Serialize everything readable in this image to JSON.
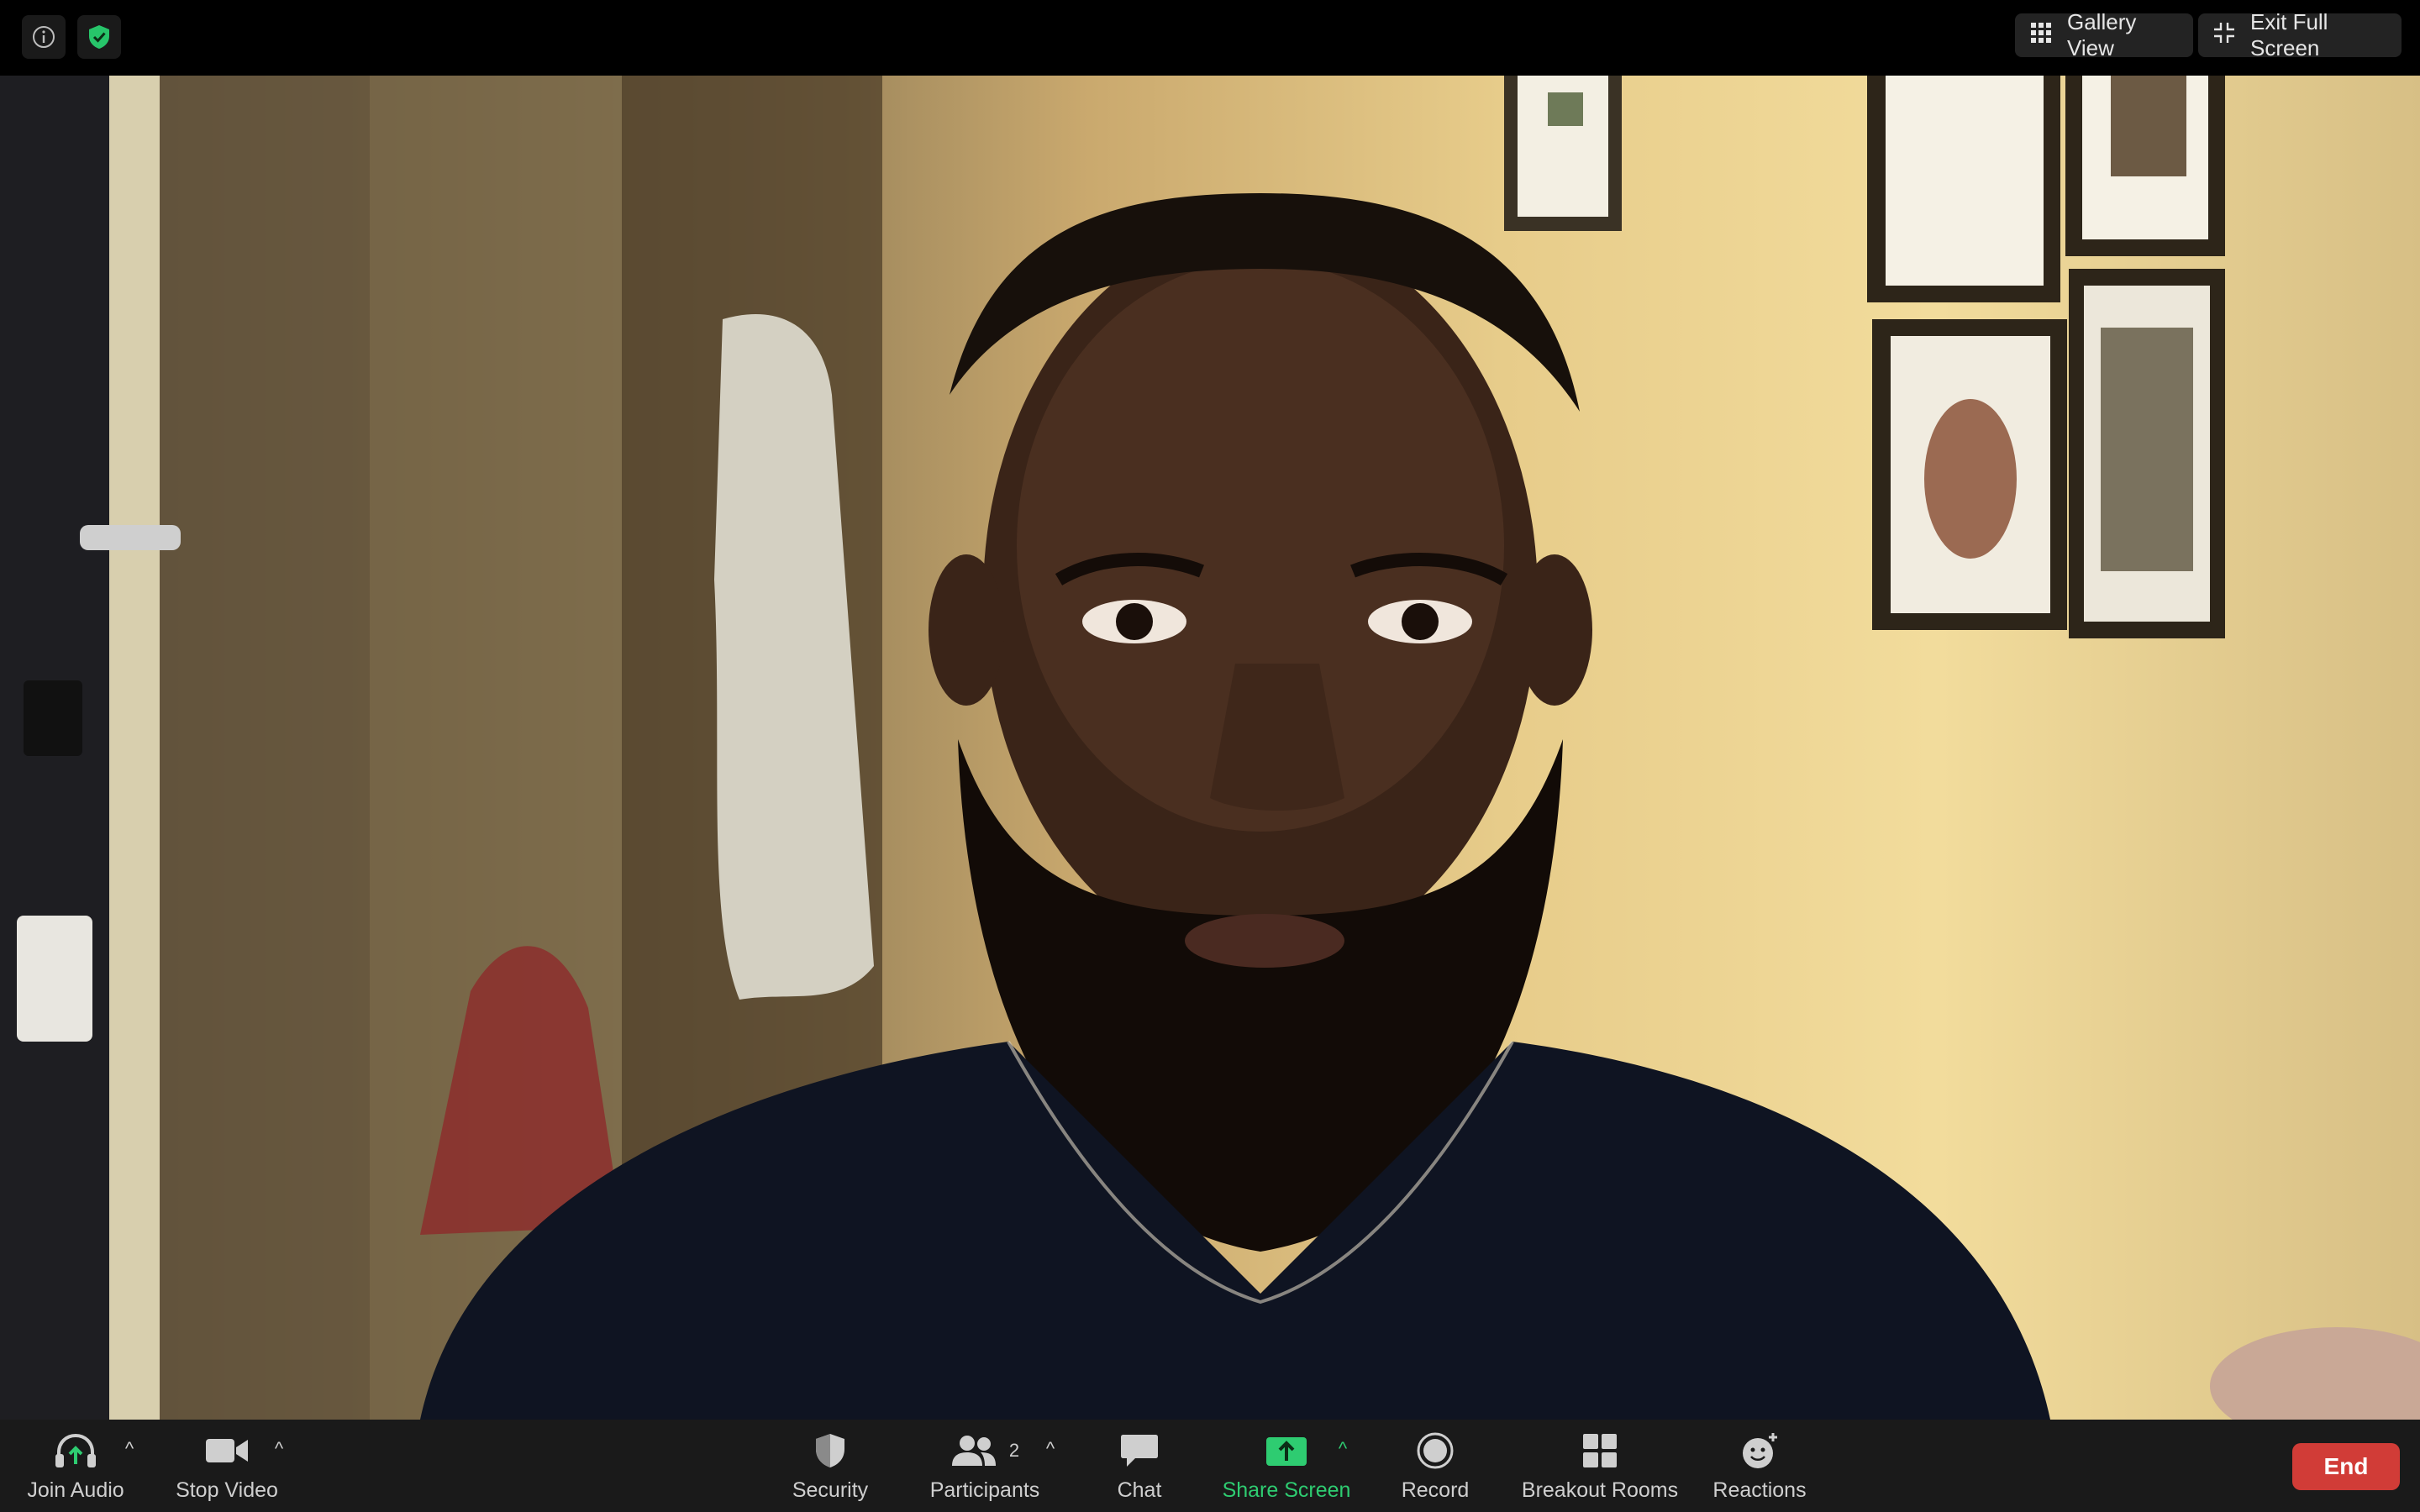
{
  "top_bar": {
    "gallery_view_label": "Gallery View",
    "exit_full_screen_label": "Exit Full Screen",
    "icons": [
      "info-icon",
      "shield-check-icon",
      "grid-icon",
      "exit-fullscreen-icon"
    ]
  },
  "toolbar": {
    "join_audio": "Join Audio",
    "stop_video": "Stop Video",
    "security": "Security",
    "participants": "Participants",
    "participants_count": "2",
    "chat": "Chat",
    "share_screen": "Share Screen",
    "record": "Record",
    "breakout_rooms": "Breakout Rooms",
    "reactions": "Reactions",
    "end": "End"
  },
  "colors": {
    "share_green": "#2ecc71",
    "end_red": "#d13c37",
    "shield_green": "#27c56a",
    "toolbar_bg": "#1a1a1a",
    "topbar_bg": "#000000"
  }
}
